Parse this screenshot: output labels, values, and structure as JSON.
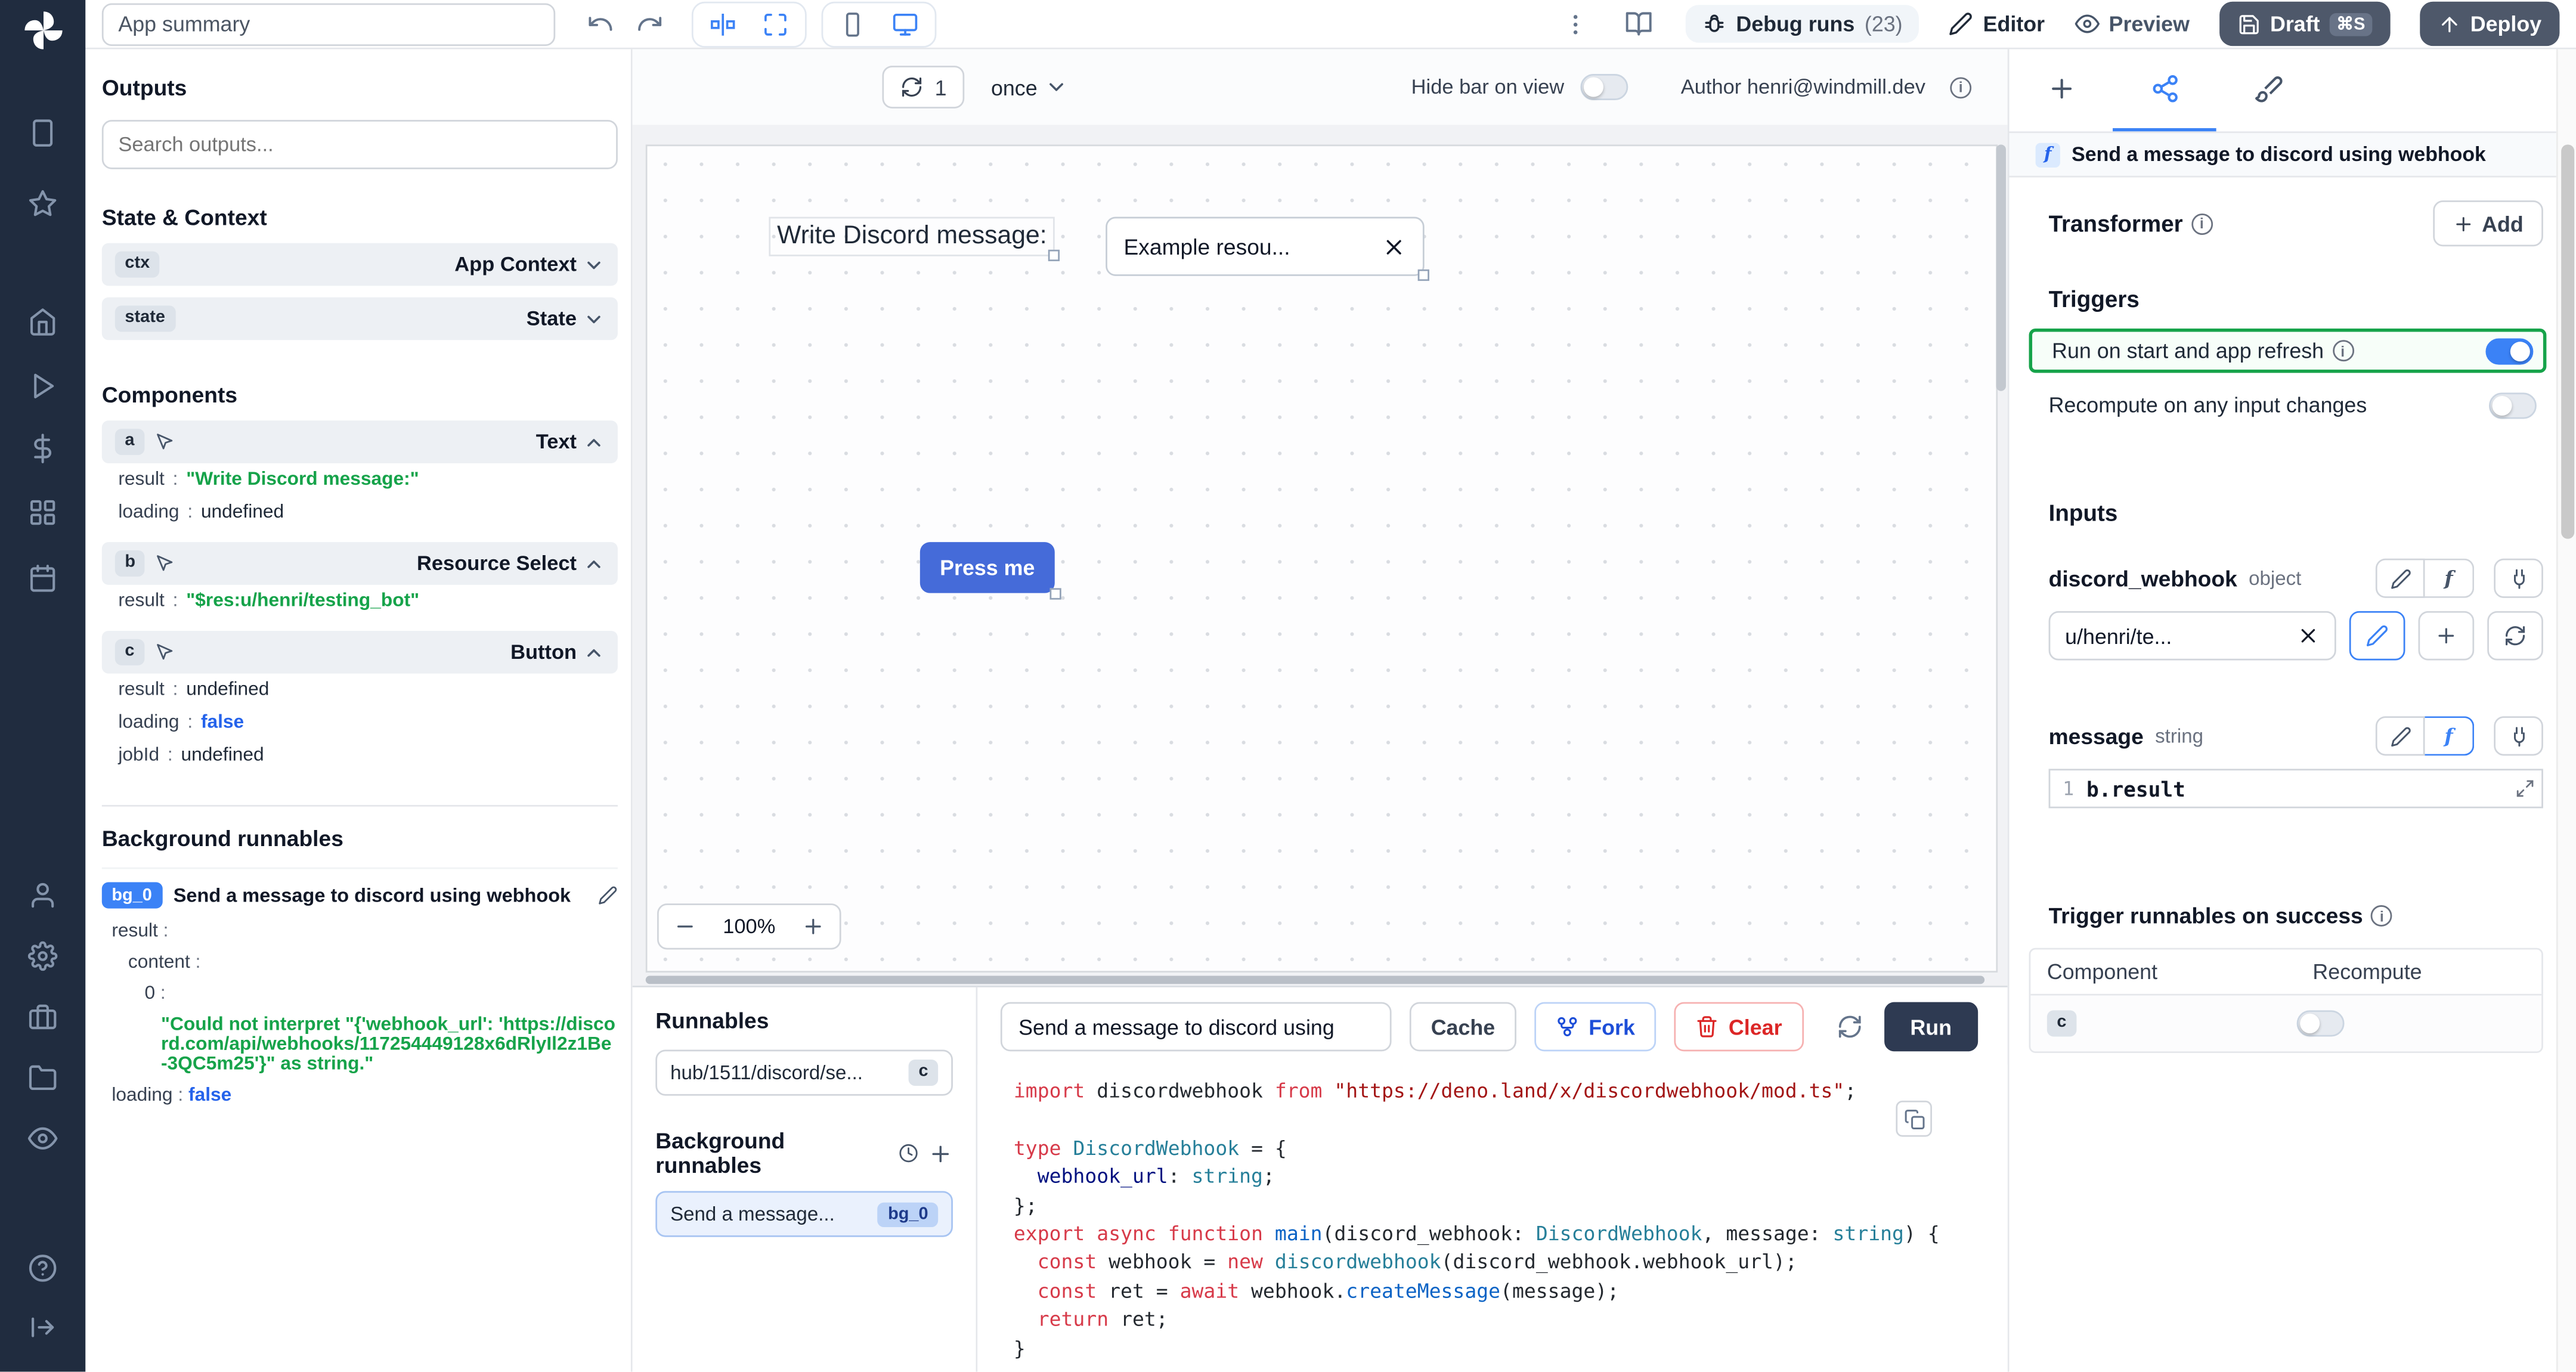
{
  "colors": {
    "accent": "#3b82f6",
    "rail_bg": "#202c3f",
    "success_green": "#16a34a",
    "danger_red": "#dc2626",
    "button_blue": "#456bd9",
    "dark_button": "#4e586a",
    "run_button": "#2e3a52"
  },
  "topbar": {
    "app_summary": "App summary",
    "debug_runs": "Debug runs",
    "debug_count": "(23)",
    "editor": "Editor",
    "preview": "Preview",
    "draft": "Draft",
    "draft_shortcut": "⌘S",
    "deploy": "Deploy"
  },
  "canvas_bar": {
    "refresh_count": "1",
    "mode": "once",
    "hide_bar_label": "Hide bar on view",
    "author": "Author henri@windmill.dev"
  },
  "canvas": {
    "text_component": "Write Discord message:",
    "select_value": "Example resou...",
    "button_label": "Press me",
    "zoom": "100%"
  },
  "outputs": {
    "title": "Outputs",
    "search_placeholder": "Search outputs...",
    "state_context_title": "State & Context",
    "ctx_badge": "ctx",
    "ctx_label": "App Context",
    "state_badge": "state",
    "state_label": "State",
    "components_title": "Components",
    "comp_a": {
      "badge": "a",
      "type": "Text",
      "result_key": "result",
      "result_val": "\"Write Discord message:\"",
      "loading_key": "loading",
      "loading_val": "undefined"
    },
    "comp_b": {
      "badge": "b",
      "type": "Resource Select",
      "result_key": "result",
      "result_val": "\"$res:u/henri/testing_bot\""
    },
    "comp_c": {
      "badge": "c",
      "type": "Button",
      "result_key": "result",
      "result_val": "undefined",
      "loading_key": "loading",
      "loading_val": "false",
      "jobid_key": "jobId",
      "jobid_val": "undefined"
    },
    "bg_title": "Background runnables",
    "bg_badge": "bg_0",
    "bg_name": "Send a message to discord using webhook",
    "bg_result_key": "result",
    "bg_content_key": "content",
    "bg_zero_key": "0",
    "bg_error": "\"Could not interpret \"{'webhook_url': 'https://discord.com/api/webhooks/117254449128x6dRlyIl2z1Be-3QC5m25'}\" as string.\"",
    "bg_loading_key": "loading",
    "bg_loading_val": "false",
    "colon": ":"
  },
  "runnables": {
    "title": "Runnables",
    "item_path": "hub/1511/discord/se...",
    "item_badge": "c",
    "bg_title": "Background runnables",
    "bg_item_name": "Send a message...",
    "bg_item_badge": "bg_0"
  },
  "editor_head": {
    "title": "Send a message to discord using",
    "cache": "Cache",
    "fork": "Fork",
    "clear": "Clear",
    "run": "Run"
  },
  "code": {
    "lines": [
      [
        {
          "c": "kw",
          "t": "import"
        },
        {
          "c": "pl",
          "t": " discordwebhook "
        },
        {
          "c": "kw",
          "t": "from"
        },
        {
          "c": "pl",
          "t": " "
        },
        {
          "c": "st",
          "t": "\"https://deno.land/x/discordwebhook/mod.ts\""
        },
        {
          "c": "pl",
          "t": ";"
        }
      ],
      [],
      [
        {
          "c": "kw",
          "t": "type"
        },
        {
          "c": "pl",
          "t": " "
        },
        {
          "c": "ty",
          "t": "DiscordWebhook"
        },
        {
          "c": "pl",
          "t": " = {"
        }
      ],
      [
        {
          "c": "pl",
          "t": "  "
        },
        {
          "c": "vr",
          "t": "webhook_url"
        },
        {
          "c": "pl",
          "t": ": "
        },
        {
          "c": "ty",
          "t": "string"
        },
        {
          "c": "pl",
          "t": ";"
        }
      ],
      [
        {
          "c": "pl",
          "t": "};"
        }
      ],
      [
        {
          "c": "kw",
          "t": "export"
        },
        {
          "c": "pl",
          "t": " "
        },
        {
          "c": "kw",
          "t": "async"
        },
        {
          "c": "pl",
          "t": " "
        },
        {
          "c": "kw",
          "t": "function"
        },
        {
          "c": "pl",
          "t": " "
        },
        {
          "c": "fn",
          "t": "main"
        },
        {
          "c": "pl",
          "t": "(discord_webhook: "
        },
        {
          "c": "ty",
          "t": "DiscordWebhook"
        },
        {
          "c": "pl",
          "t": ", message: "
        },
        {
          "c": "ty",
          "t": "string"
        },
        {
          "c": "pl",
          "t": ") {"
        }
      ],
      [
        {
          "c": "pl",
          "t": "  "
        },
        {
          "c": "kw",
          "t": "const"
        },
        {
          "c": "pl",
          "t": " webhook = "
        },
        {
          "c": "kw",
          "t": "new"
        },
        {
          "c": "pl",
          "t": " "
        },
        {
          "c": "ty",
          "t": "discordwebhook"
        },
        {
          "c": "pl",
          "t": "(discord_webhook.webhook_url);"
        }
      ],
      [
        {
          "c": "pl",
          "t": "  "
        },
        {
          "c": "kw",
          "t": "const"
        },
        {
          "c": "pl",
          "t": " ret = "
        },
        {
          "c": "kw",
          "t": "await"
        },
        {
          "c": "pl",
          "t": " webhook."
        },
        {
          "c": "fn",
          "t": "createMessage"
        },
        {
          "c": "pl",
          "t": "(message);"
        }
      ],
      [
        {
          "c": "pl",
          "t": "  "
        },
        {
          "c": "kw",
          "t": "return"
        },
        {
          "c": "pl",
          "t": " ret;"
        }
      ],
      [
        {
          "c": "pl",
          "t": "}"
        }
      ]
    ]
  },
  "settings": {
    "header": "Send a message to discord using webhook",
    "transformer": "Transformer",
    "add": "Add",
    "triggers": "Triggers",
    "run_on_start": "Run on start and app refresh",
    "recompute": "Recompute on any input changes",
    "inputs": "Inputs",
    "field1_name": "discord_webhook",
    "field1_type": "object",
    "resource_value": "u/henri/te...",
    "field2_name": "message",
    "field2_type": "string",
    "expr_line_no": "1",
    "expr": "b.result",
    "trigger_success": "Trigger runnables on success",
    "col_component": "Component",
    "col_recompute": "Recompute",
    "row_badge": "c",
    "fn_glyph": "f"
  }
}
